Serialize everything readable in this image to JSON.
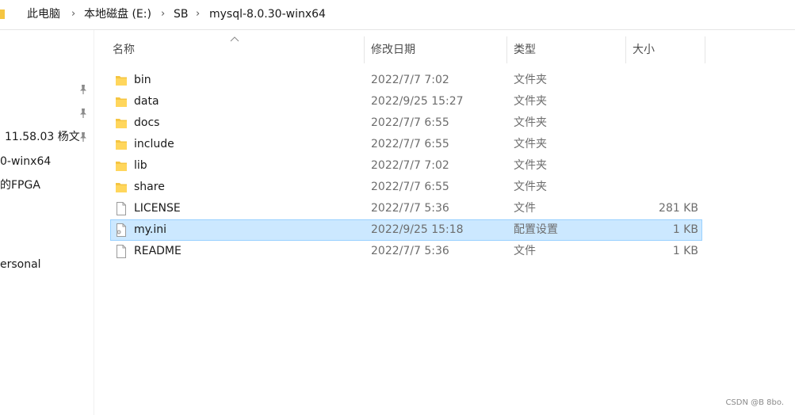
{
  "breadcrumb": {
    "items": [
      "此电脑",
      "本地磁盘 (E:)",
      "SB",
      "mysql-8.0.30-winx64"
    ],
    "separator": "›"
  },
  "nav": {
    "items": [
      "11.58.03 杨文",
      "0-winx64",
      "的FPGA",
      "ersonal"
    ]
  },
  "columns": {
    "name": "名称",
    "date": "修改日期",
    "type": "类型",
    "size": "大小"
  },
  "files": [
    {
      "name": "bin",
      "date": "2022/7/7 7:02",
      "type": "文件夹",
      "size": "",
      "icon": "folder-icon"
    },
    {
      "name": "data",
      "date": "2022/9/25 15:27",
      "type": "文件夹",
      "size": "",
      "icon": "folder-icon"
    },
    {
      "name": "docs",
      "date": "2022/7/7 6:55",
      "type": "文件夹",
      "size": "",
      "icon": "folder-icon"
    },
    {
      "name": "include",
      "date": "2022/7/7 6:55",
      "type": "文件夹",
      "size": "",
      "icon": "folder-icon"
    },
    {
      "name": "lib",
      "date": "2022/7/7 7:02",
      "type": "文件夹",
      "size": "",
      "icon": "folder-icon"
    },
    {
      "name": "share",
      "date": "2022/7/7 6:55",
      "type": "文件夹",
      "size": "",
      "icon": "folder-icon"
    },
    {
      "name": "LICENSE",
      "date": "2022/7/7 5:36",
      "type": "文件",
      "size": "281 KB",
      "icon": "file-icon"
    },
    {
      "name": "my.ini",
      "date": "2022/9/25 15:18",
      "type": "配置设置",
      "size": "1 KB",
      "icon": "settings-file-icon",
      "selected": true
    },
    {
      "name": "README",
      "date": "2022/7/7 5:36",
      "type": "文件",
      "size": "1 KB",
      "icon": "file-icon"
    }
  ],
  "watermark": "CSDN @B 8bo.",
  "colors": {
    "selection_bg": "#cce8ff",
    "selection_border": "#99d1ff",
    "folder": "#f5c542"
  }
}
